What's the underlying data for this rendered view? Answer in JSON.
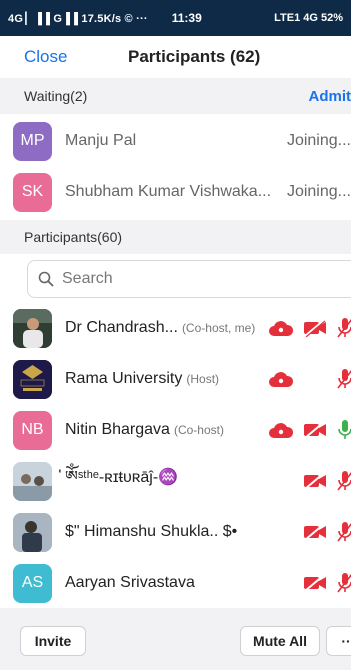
{
  "status_bar": {
    "left": "4G ▏▐▐ G▐▐ 17.5K/s © ···",
    "time": "11:39",
    "right": "LTE1 4G 52%"
  },
  "header": {
    "close_label": "Close",
    "title": "Participants (62)"
  },
  "waiting_section": {
    "label": "Waiting(2)",
    "admit_label": "Admit"
  },
  "waiting": [
    {
      "initials": "MP",
      "name": "Manju Pal",
      "status": "Joining...",
      "color": "#8e6cc4"
    },
    {
      "initials": "SK",
      "name": "Shubham Kumar Vishwaka...",
      "status": "Joining...",
      "color": "#e86c95"
    }
  ],
  "participants_section": {
    "label": "Participants(60)"
  },
  "search": {
    "placeholder": "Search"
  },
  "participants": [
    {
      "initials": "",
      "name": "Dr Chandrash...",
      "role": "(Co-host, me)",
      "avatar": "photo",
      "cloud": true,
      "video": "off",
      "audio": "muted"
    },
    {
      "initials": "",
      "name": "Rama University",
      "role": "(Host)",
      "avatar": "logo",
      "cloud": true,
      "video": "none",
      "audio": "muted"
    },
    {
      "initials": "NB",
      "name": "Nitin Bhargava",
      "role": "(Co-host)",
      "avatar": "initials",
      "color": "#e86c95",
      "cloud": true,
      "video": "off",
      "audio": "on"
    },
    {
      "initials": "",
      "name": "່ༀˢᵗʰᵉ-ʀɪŧᴜʀāĵ-♒",
      "role": "",
      "avatar": "photo",
      "cloud": false,
      "video": "off",
      "audio": "muted"
    },
    {
      "initials": "",
      "name": "$\" Himanshu Shukla.. $•",
      "role": "",
      "avatar": "photo",
      "cloud": false,
      "video": "off",
      "audio": "muted"
    },
    {
      "initials": "AS",
      "name": "Aaryan Srivastava",
      "role": "",
      "avatar": "initials",
      "color": "#3fbcd1",
      "cloud": false,
      "video": "off",
      "audio": "muted"
    }
  ],
  "bottom": {
    "invite_label": "Invite",
    "mute_all_label": "Mute All",
    "more_label": "··"
  },
  "colors": {
    "accent": "#1a73e8",
    "red": "#e5303b",
    "green": "#3bb34a"
  },
  "icons": [
    "search-icon",
    "cloud-recording-icon",
    "video-off-icon",
    "mic-muted-icon",
    "mic-on-icon"
  ]
}
